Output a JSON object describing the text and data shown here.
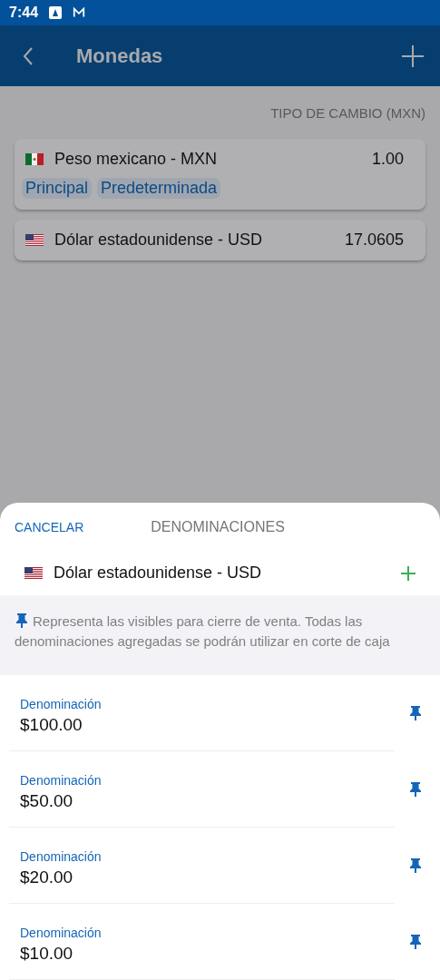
{
  "status_bar": {
    "time": "7:44"
  },
  "app_bar": {
    "title": "Monedas"
  },
  "list_header": "TIPO DE CAMBIO (MXN)",
  "currencies": [
    {
      "flag": {
        "kind": "mx"
      },
      "name": "Peso mexicano - MXN",
      "rate": "1.00",
      "tags": [
        "Principal",
        "Predeterminada"
      ]
    },
    {
      "flag": {
        "kind": "us"
      },
      "name": "Dólar estadounidense - USD",
      "rate": "17.0605"
    }
  ],
  "sheet": {
    "cancel": "CANCELAR",
    "title": "DENOMINACIONES",
    "currency": {
      "flag": {
        "kind": "us"
      },
      "name": "Dólar estadounidense - USD"
    },
    "info": "Representa las visibles para cierre de venta. Todas las denominaciones agregadas se podrán utilizar en corte de caja",
    "denominations": [
      {
        "label": "Denominación",
        "value": "$100.00",
        "pinned": true
      },
      {
        "label": "Denominación",
        "value": "$50.00",
        "pinned": true
      },
      {
        "label": "Denominación",
        "value": "$20.00",
        "pinned": true
      },
      {
        "label": "Denominación",
        "value": "$10.00",
        "pinned": true
      }
    ]
  }
}
